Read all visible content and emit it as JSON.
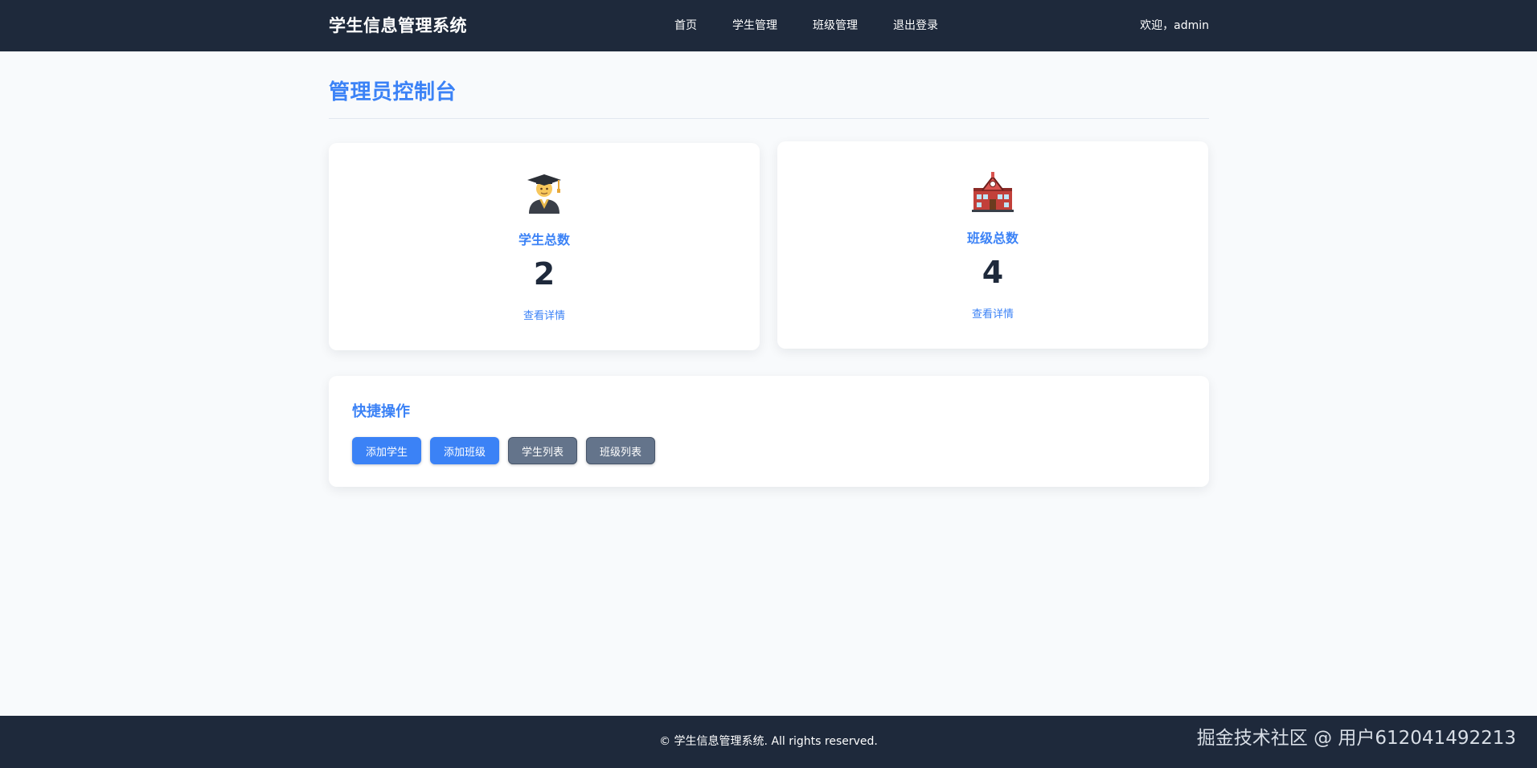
{
  "header": {
    "brand": "学生信息管理系统",
    "nav": [
      "首页",
      "学生管理",
      "班级管理",
      "退出登录"
    ],
    "welcome": "欢迎，admin"
  },
  "main": {
    "title": "管理员控制台",
    "stats": [
      {
        "icon": "student-graduate-icon",
        "label": "学生总数",
        "value": "2",
        "link": "查看详情"
      },
      {
        "icon": "school-building-icon",
        "label": "班级总数",
        "value": "4",
        "link": "查看详情"
      }
    ],
    "quick": {
      "title": "快捷操作",
      "buttons": [
        "添加学生",
        "添加班级",
        "学生列表",
        "班级列表"
      ]
    }
  },
  "footer": {
    "copyright": "© 学生信息管理系统. All rights reserved.",
    "watermark": "掘金技术社区 @ 用户612041492213"
  },
  "colors": {
    "nav_bg": "#1e293b",
    "accent": "#3b82f6",
    "secondary_button": "#64748b",
    "page_bg": "#f8fafc"
  }
}
